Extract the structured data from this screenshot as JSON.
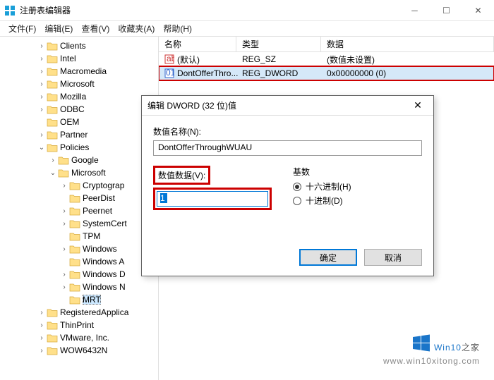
{
  "window": {
    "title": "注册表编辑器",
    "menu": [
      "文件(F)",
      "编辑(E)",
      "查看(V)",
      "收藏夹(A)",
      "帮助(H)"
    ]
  },
  "tree": [
    {
      "depth": 3,
      "exp": ">",
      "label": "Clients"
    },
    {
      "depth": 3,
      "exp": ">",
      "label": "Intel"
    },
    {
      "depth": 3,
      "exp": ">",
      "label": "Macromedia"
    },
    {
      "depth": 3,
      "exp": ">",
      "label": "Microsoft"
    },
    {
      "depth": 3,
      "exp": ">",
      "label": "Mozilla"
    },
    {
      "depth": 3,
      "exp": ">",
      "label": "ODBC"
    },
    {
      "depth": 3,
      "exp": " ",
      "label": "OEM"
    },
    {
      "depth": 3,
      "exp": ">",
      "label": "Partner"
    },
    {
      "depth": 3,
      "exp": "v",
      "label": "Policies"
    },
    {
      "depth": 4,
      "exp": ">",
      "label": "Google"
    },
    {
      "depth": 4,
      "exp": "v",
      "label": "Microsoft"
    },
    {
      "depth": 5,
      "exp": ">",
      "label": "Cryptograp"
    },
    {
      "depth": 5,
      "exp": " ",
      "label": "PeerDist"
    },
    {
      "depth": 5,
      "exp": ">",
      "label": "Peernet"
    },
    {
      "depth": 5,
      "exp": ">",
      "label": "SystemCert"
    },
    {
      "depth": 5,
      "exp": " ",
      "label": "TPM"
    },
    {
      "depth": 5,
      "exp": ">",
      "label": "Windows"
    },
    {
      "depth": 5,
      "exp": " ",
      "label": "Windows A"
    },
    {
      "depth": 5,
      "exp": ">",
      "label": "Windows D"
    },
    {
      "depth": 5,
      "exp": ">",
      "label": "Windows N"
    },
    {
      "depth": 5,
      "exp": " ",
      "label": "MRT",
      "selected": true
    },
    {
      "depth": 3,
      "exp": ">",
      "label": "RegisteredApplica"
    },
    {
      "depth": 3,
      "exp": ">",
      "label": "ThinPrint"
    },
    {
      "depth": 3,
      "exp": ">",
      "label": "VMware, Inc."
    },
    {
      "depth": 3,
      "exp": ">",
      "label": "WOW6432N"
    }
  ],
  "list": {
    "headers": {
      "name": "名称",
      "type": "类型",
      "data": "数据"
    },
    "rows": [
      {
        "icon": "str",
        "name": "(默认)",
        "type": "REG_SZ",
        "data": "(数值未设置)"
      },
      {
        "icon": "bin",
        "name": "DontOfferThro...",
        "type": "REG_DWORD",
        "data": "0x00000000 (0)",
        "selected": true
      }
    ]
  },
  "dialog": {
    "title": "编辑 DWORD (32 位)值",
    "name_label": "数值名称(N):",
    "name_value": "DontOfferThroughWUAU",
    "value_label": "数值数据(V):",
    "value_input": "1",
    "base_label": "基数",
    "radio_hex": "十六进制(H)",
    "radio_dec": "十进制(D)",
    "ok": "确定",
    "cancel": "取消"
  },
  "watermark": {
    "brand": "Win10",
    "suffix": "之家",
    "url": "www.win10xitong.com"
  }
}
